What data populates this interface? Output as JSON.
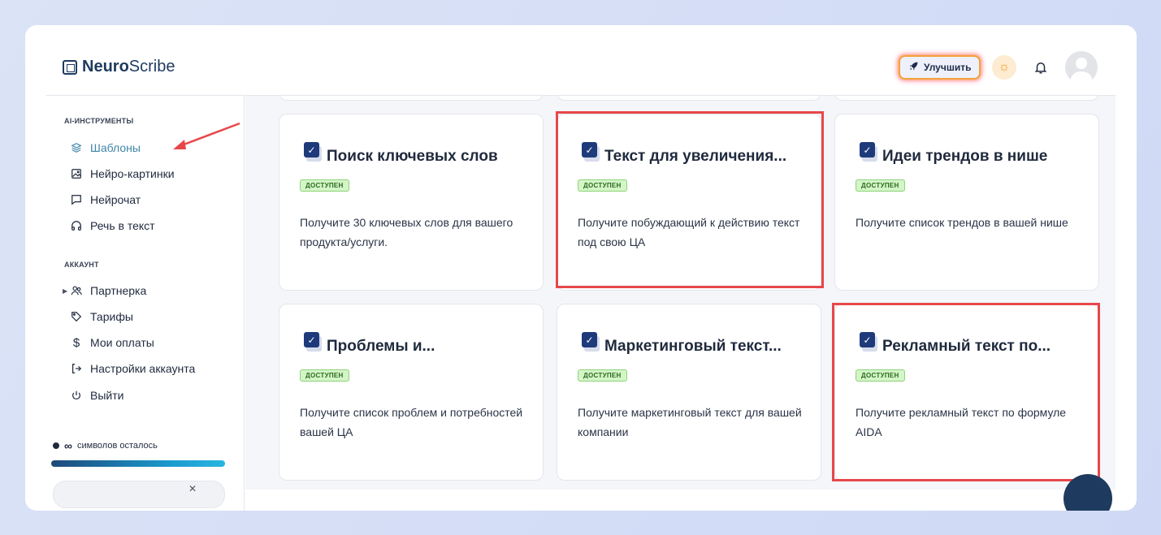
{
  "brand": {
    "bold": "Neuro",
    "light": "Scribe"
  },
  "header": {
    "upgrade_label": "Улучшить"
  },
  "sidebar": {
    "section_tools": "AI-ИНСТРУМЕНТЫ",
    "tools": [
      {
        "label": "Шаблоны",
        "icon": "layers-icon",
        "active": true
      },
      {
        "label": "Нейро-картинки",
        "icon": "image-icon"
      },
      {
        "label": "Нейрочат",
        "icon": "chat-icon"
      },
      {
        "label": "Речь в текст",
        "icon": "headphones-icon"
      }
    ],
    "section_account": "АККАУНТ",
    "account": [
      {
        "label": "Партнерка",
        "icon": "users-icon"
      },
      {
        "label": "Тарифы",
        "icon": "tag-icon"
      },
      {
        "label": "Мои оплаты",
        "icon": "dollar-icon"
      },
      {
        "label": "Настройки аккаунта",
        "icon": "login-icon"
      },
      {
        "label": "Выйти",
        "icon": "power-icon"
      }
    ],
    "credits_symbol": "∞",
    "credits_text": "символов осталось"
  },
  "cards": [
    {
      "title": "Поиск ключевых слов",
      "badge": "ДОСТУПЕН",
      "desc": "Получите 30 ключевых слов для вашего продукта/услуги."
    },
    {
      "title": "Текст для увеличения...",
      "badge": "ДОСТУПЕН",
      "desc": "Получите побуждающий к действию текст под свою ЦА"
    },
    {
      "title": "Идеи трендов в нише",
      "badge": "ДОСТУПЕН",
      "desc": "Получите список трендов в вашей нише"
    },
    {
      "title": "Проблемы и...",
      "badge": "ДОСТУПЕН",
      "desc": "Получите список проблем и потребностей вашей ЦА"
    },
    {
      "title": "Маркетинговый текст...",
      "badge": "ДОСТУПЕН",
      "desc": "Получите маркетинговый текст для вашей компании"
    },
    {
      "title": "Рекламный текст по...",
      "badge": "ДОСТУПЕН",
      "desc": "Получите рекламный текст по формуле AIDA"
    }
  ],
  "colors": {
    "accent": "#3f86a8",
    "highlight": "#e8474a",
    "badge_bg": "#d3f5c7"
  }
}
